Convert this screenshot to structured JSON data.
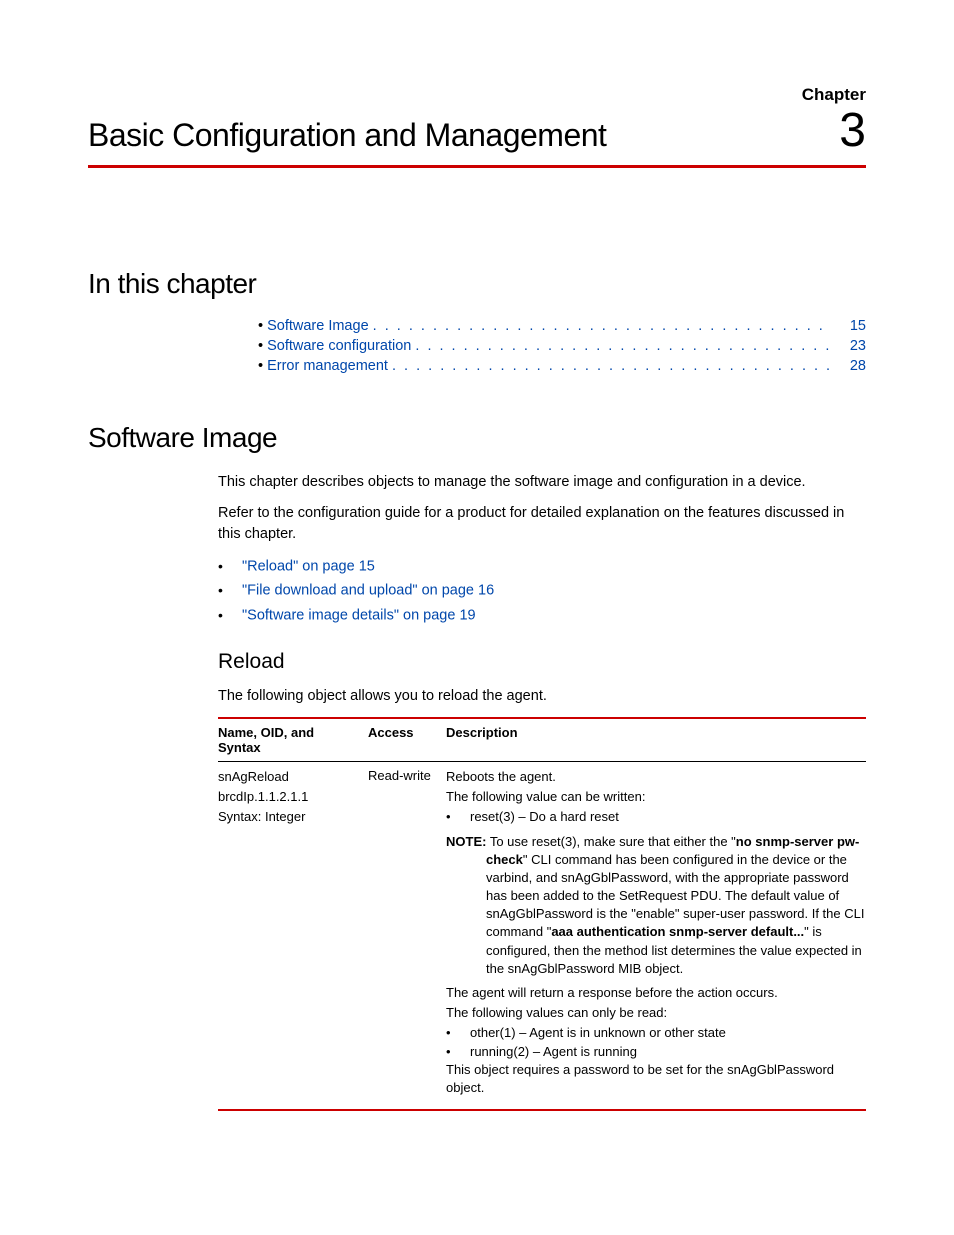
{
  "chapter": {
    "label": "Chapter",
    "number": "3",
    "title": "Basic Configuration and Management"
  },
  "sections": {
    "in_this_chapter": "In this chapter",
    "software_image": "Software Image",
    "reload": "Reload"
  },
  "toc": [
    {
      "label": "Software Image",
      "page": "15"
    },
    {
      "label": "Software configuration",
      "page": "23"
    },
    {
      "label": "Error management",
      "page": "28"
    }
  ],
  "software_image": {
    "intro1": "This chapter describes objects to manage the software image and configuration in a device.",
    "intro2": "Refer to the configuration guide for a product for detailed explanation on the features discussed in this chapter.",
    "links": [
      "\"Reload\" on page 15",
      "\"File download and upload\" on page 16",
      "\"Software image details\" on page 19"
    ]
  },
  "reload": {
    "intro": "The following object allows you to reload the agent."
  },
  "table": {
    "headers": {
      "c1": "Name, OID, and Syntax",
      "c2": "Access",
      "c3": "Description"
    },
    "row": {
      "name": "snAgReload",
      "oid": "brcdIp.1.1.2.1.1",
      "syntax": "Syntax: Integer",
      "access": "Read-write",
      "desc": {
        "l1": "Reboots the agent.",
        "l2": "The following value can be written:",
        "b1": "reset(3) – Do a hard reset",
        "note_label": "NOTE:",
        "note_pre": "To use reset(3), make sure that either the \"",
        "note_bold1": "no snmp-server pw-check",
        "note_mid1": "\" CLI command has been configured in the device or the varbind, and snAgGblPassword, with the appropriate password has been added to the SetRequest PDU. The default value of snAgGblPassword is the \"enable\" super-user password. If the CLI command \"",
        "note_bold2": "aaa authentication snmp-server default...",
        "note_mid2": "\" is configured, then the method list determines the value expected in the snAgGblPassword MIB object.",
        "l3": "The agent will return a response before the action occurs.",
        "l4": "The following values can only be read:",
        "b2": "other(1) – Agent is in unknown or other state",
        "b3": "running(2) – Agent is running",
        "l5": "This object requires a password to be set for the snAgGblPassword object."
      }
    }
  }
}
